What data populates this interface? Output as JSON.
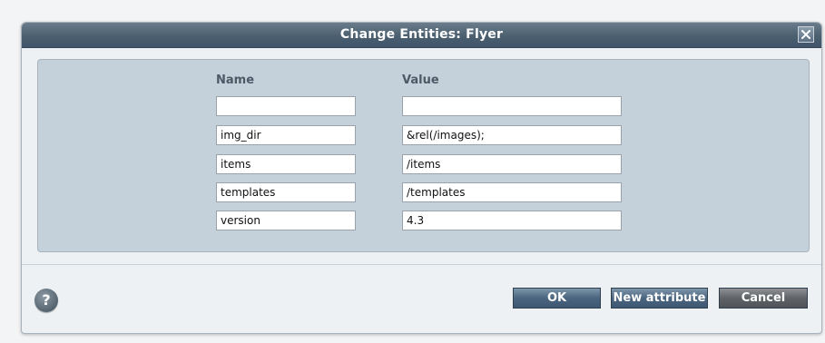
{
  "dialog": {
    "title": "Change Entities: Flyer",
    "close_label": "✕"
  },
  "table": {
    "name_header": "Name",
    "value_header": "Value",
    "rows": [
      {
        "name": "",
        "value": ""
      },
      {
        "name": "img_dir",
        "value": "&rel(/images);"
      },
      {
        "name": "items",
        "value": "/items"
      },
      {
        "name": "templates",
        "value": "/templates"
      },
      {
        "name": "version",
        "value": "4.3"
      }
    ]
  },
  "footer": {
    "help_label": "?",
    "ok_label": "OK",
    "new_attribute_label": "New attribute",
    "cancel_label": "Cancel"
  }
}
